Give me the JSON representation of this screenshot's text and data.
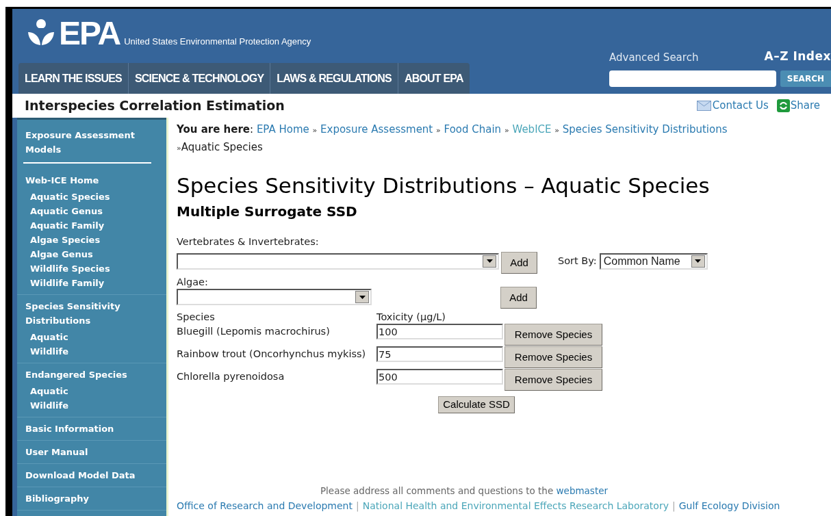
{
  "header": {
    "logo_text": "EPA",
    "agency": "United States Environmental Protection Agency",
    "nav": [
      "LEARN THE ISSUES",
      "SCIENCE & TECHNOLOGY",
      "LAWS & REGULATIONS",
      "ABOUT EPA"
    ],
    "advanced_search": "Advanced Search",
    "az_index": "A–Z Index",
    "search_button": "SEARCH"
  },
  "title_bar": {
    "title": "Interspecies Correlation Estimation",
    "contact": "Contact Us",
    "share": "Share"
  },
  "sidebar": [
    {
      "title": "Exposure Assessment Models",
      "underlined": true
    },
    {
      "title": "Web-ICE Home",
      "items": [
        "Aquatic Species",
        "Aquatic Genus",
        "Aquatic Family",
        "Algae Species",
        "Algae Genus",
        "Wildlife Species",
        "Wildlife Family"
      ]
    },
    {
      "title": "Species Sensitivity Distributions",
      "items": [
        "Aquatic",
        "Wildlife"
      ]
    },
    {
      "title": "Endangered Species",
      "items": [
        "Aquatic",
        "Wildlife"
      ]
    },
    {
      "title": "Basic Information"
    },
    {
      "title": "User Manual"
    },
    {
      "title": "Download Model Data"
    },
    {
      "title": "Bibliography"
    }
  ],
  "breadcrumb": {
    "label": "**You are here**:",
    "items": [
      {
        "kind": "link",
        "text": "EPA Home",
        "visited": false
      },
      {
        "kind": "separator",
        "text": "»"
      },
      {
        "kind": "link",
        "text": "Exposure Assessment",
        "visited": false
      },
      {
        "kind": "separator",
        "text": "»"
      },
      {
        "kind": "link",
        "text": "Food Chain",
        "visited": false
      },
      {
        "kind": "separator",
        "text": "»"
      },
      {
        "kind": "link",
        "text": "WebICE",
        "visited": true
      },
      {
        "kind": "separator",
        "text": "»"
      },
      {
        "kind": "link",
        "text": "Species Sensitivity Distributions",
        "visited": false
      },
      {
        "kind": "separator",
        "text": "»"
      },
      {
        "kind": "current",
        "text": "Aquatic Species"
      }
    ]
  },
  "heading": "Species Sensitivity Distributions – Aquatic Species",
  "subheading": "Multiple Surrogate SSD",
  "form": {
    "vertebrates_label": "Vertebrates & Invertebrates:",
    "add_button": "Add",
    "sort_label": "Sort By:",
    "sort_value": "Common Name",
    "algae_label": "Algae:",
    "algae_add_button": "Add",
    "columns": [
      "Species",
      "Toxicity (µg/L)"
    ],
    "rows": [
      {
        "species": "Bluegill (Lepomis macrochirus)",
        "toxicity": "100",
        "button": "Remove Species"
      },
      {
        "species": "Rainbow trout (Oncorhynchus mykiss)",
        "toxicity": "75",
        "button": "Remove Species"
      },
      {
        "species": "Chlorella pyrenoidosa",
        "toxicity": "500",
        "button": "Remove Species"
      }
    ],
    "calculate_button": "Calculate SSD"
  },
  "footer": {
    "note": "Please address all comments and questions to the",
    "note_link": "webmaster",
    "links": [
      {
        "text": "Office of Research and Development",
        "visited": false
      },
      {
        "text": "National Health and Environmental Effects Research Laboratory",
        "visited": true
      },
      {
        "text": "Gulf Ecology Division",
        "visited": false
      }
    ],
    "separator": "|"
  }
}
